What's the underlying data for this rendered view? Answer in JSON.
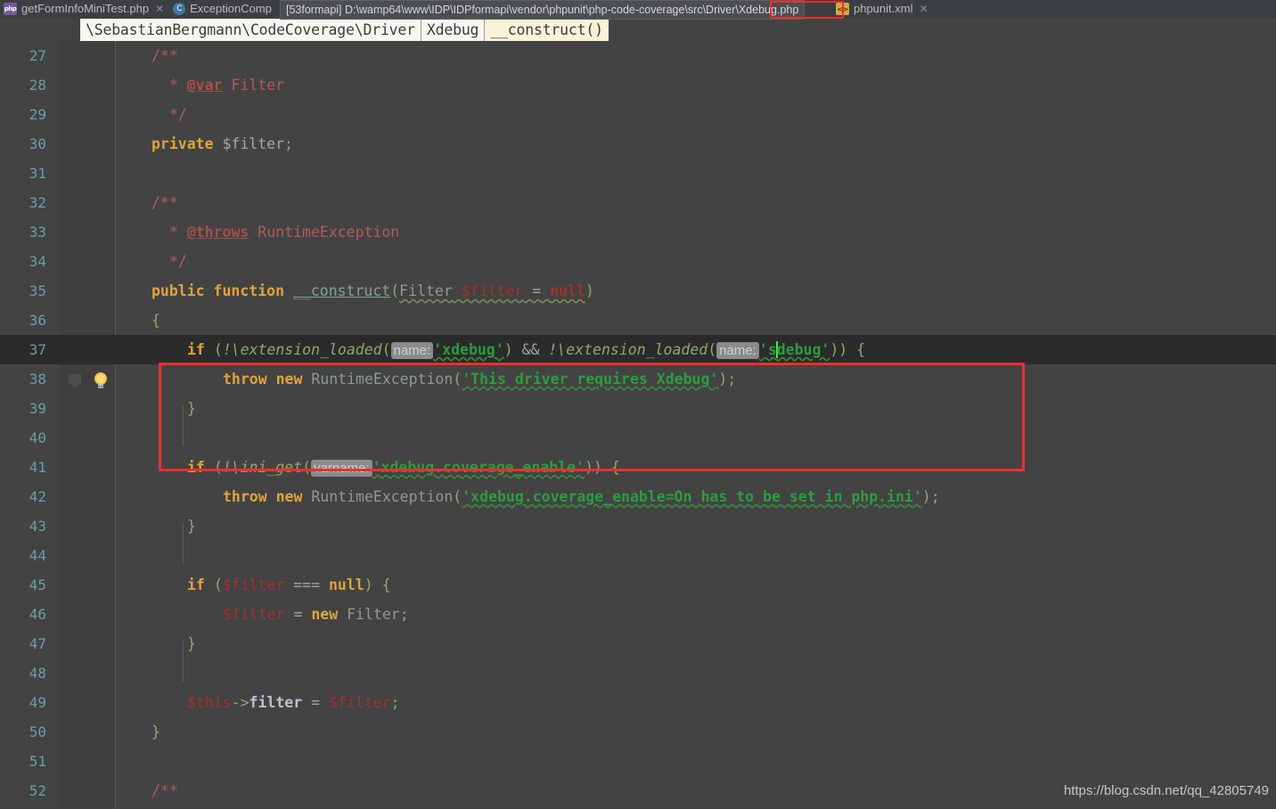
{
  "window": {
    "watermark": "https://blog.csdn.net/qq_42805749"
  },
  "tabbar": {
    "tabs": [
      {
        "label": "getFormInfoMiniTest.php",
        "icon": "php-file-icon",
        "icon_text": "php",
        "close": "✕",
        "active": false
      },
      {
        "label": "ExceptionComp",
        "icon": "php-class-icon",
        "icon_text": "C",
        "close": "✕",
        "active": false
      },
      {
        "label": "phpunit.xml",
        "icon": "xml-file-icon",
        "icon_text": "<>",
        "close": "✕",
        "active": false
      }
    ]
  },
  "tooltip": {
    "module": "[53formapi]",
    "path_prefix": "D:\\wamp64\\www\\IDP\\IDPformapi\\vendor\\phpunit\\php-code-coverage\\src\\Driver\\",
    "file": "Xdebug.php",
    "full": "[53formapi] D:\\wamp64\\www\\IDP\\IDPformapi\\vendor\\phpunit\\php-code-coverage\\src\\Driver\\Xdebug.php",
    "highlight_color": "#f02d2d"
  },
  "breadcrumb": {
    "items": [
      {
        "label": "\\SebastianBergmann\\CodeCoverage\\Driver",
        "active": false
      },
      {
        "label": "Xdebug",
        "active": false
      },
      {
        "label": "__construct()",
        "active": true
      }
    ]
  },
  "editor": {
    "first_line": 27,
    "highlighted_line": 37,
    "caret_line": 37,
    "background": "#434343",
    "highlight_background": "#2b2b2b",
    "lineno_color": "#6a9ea5",
    "lines": [
      {
        "n": 27,
        "text": "    /**"
      },
      {
        "n": 28,
        "text": "     * @var Filter"
      },
      {
        "n": 29,
        "text": "     */"
      },
      {
        "n": 30,
        "text": "    private $filter;"
      },
      {
        "n": 31,
        "text": ""
      },
      {
        "n": 32,
        "text": "    /**"
      },
      {
        "n": 33,
        "text": "     * @throws RuntimeException"
      },
      {
        "n": 34,
        "text": "     */"
      },
      {
        "n": 35,
        "text": "    public function __construct(Filter $filter = null)"
      },
      {
        "n": 36,
        "text": "    {"
      },
      {
        "n": 37,
        "text": "        if (!\\extension_loaded(name: 'xdebug') && !\\extension_loaded(name: 'sdebug')) {"
      },
      {
        "n": 38,
        "text": "            throw new RuntimeException('This driver requires Xdebug');"
      },
      {
        "n": 39,
        "text": "        }"
      },
      {
        "n": 40,
        "text": ""
      },
      {
        "n": 41,
        "text": "        if (!\\ini_get(varname: 'xdebug.coverage_enable')) {"
      },
      {
        "n": 42,
        "text": "            throw new RuntimeException('xdebug.coverage_enable=On has to be set in php.ini');"
      },
      {
        "n": 43,
        "text": "        }"
      },
      {
        "n": 44,
        "text": ""
      },
      {
        "n": 45,
        "text": "        if ($filter === null) {"
      },
      {
        "n": 46,
        "text": "            $filter = new Filter;"
      },
      {
        "n": 47,
        "text": "        }"
      },
      {
        "n": 48,
        "text": ""
      },
      {
        "n": 49,
        "text": "        $this->filter = $filter;"
      },
      {
        "n": 50,
        "text": "    }"
      },
      {
        "n": 51,
        "text": ""
      },
      {
        "n": 52,
        "text": "    /**"
      }
    ],
    "param_hints": [
      {
        "line": 37,
        "label": "name:"
      },
      {
        "line": 37,
        "label": "name:"
      },
      {
        "line": 41,
        "label": "varname:"
      }
    ],
    "gutter_icons": [
      {
        "line": 37,
        "name": "intention-bulb-icon"
      },
      {
        "line": 37,
        "name": "fold-collapse-arrow-icon"
      }
    ]
  },
  "annotation": {
    "name": "red-highlight-rectangle",
    "covers_lines": "37-39",
    "color": "#f02d2d"
  }
}
